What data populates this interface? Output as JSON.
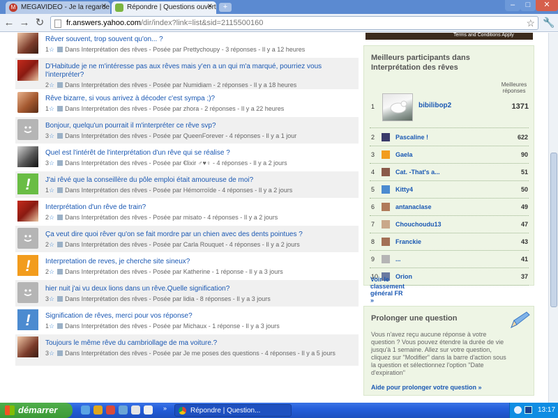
{
  "browser": {
    "tabs": [
      {
        "title": "MEGAVIDEO - Je la regarde",
        "favicon": "M",
        "active": false
      },
      {
        "title": "Répondre | Questions ouverte",
        "active": true
      }
    ],
    "url_host": "fr.answers.yahoo.com",
    "url_path": "/dir/index?link=list&sid=2115500160"
  },
  "ad": {
    "terms": "Terms and Conditions Apply"
  },
  "questions": [
    {
      "title": "Rêver souvent, trop souvent qu'on... ?",
      "stars": "1",
      "category": "Dans Interprétation des rêves",
      "asker": "Posée par Prettychoupy",
      "answers": "3 réponses",
      "age": "Il y a 12 heures",
      "avatar": "photo"
    },
    {
      "title": "D'Habitude je ne m'intéresse pas aux rêves mais y'en a un qui m'a marqué, pourriez vous l'interpréter?",
      "stars": "2",
      "category": "Dans Interprétation des rêves",
      "asker": "Posée par Numidiam",
      "answers": "2 réponses",
      "age": "Il y a 18 heures",
      "avatar": "photo"
    },
    {
      "title": "Rêve bizarre, si vous arrivez à décoder c'est sympa ;)?",
      "stars": "1",
      "category": "Dans Interprétation des rêves",
      "asker": "Posée par zhora",
      "answers": "2 réponses",
      "age": "Il y a 22 heures",
      "avatar": "photo"
    },
    {
      "title": "Bonjour, quelqu'un pourrait il m'interpréter ce rêve svp?",
      "stars": "3",
      "category": "Dans Interprétation des rêves",
      "asker": "Posée par QueenForever",
      "answers": "4 réponses",
      "age": "Il y a 1 jour",
      "avatar": "grey"
    },
    {
      "title": "Quel est l'intérêt de l'interprétation d'un rêve qui se réalise ?",
      "stars": "3",
      "category": "Dans Interprétation des rêves",
      "asker": "Posée par €lixir ♂♥♀",
      "answers": "4 réponses",
      "age": "Il y a 2 jours",
      "avatar": "photo"
    },
    {
      "title": "J'ai rêvé que la conseillère du pôle emploi était amoureuse de moi?",
      "stars": "1",
      "category": "Dans Interprétation des rêves",
      "asker": "Posée par Hémorroïde",
      "answers": "4 réponses",
      "age": "Il y a 2 jours",
      "avatar": "green"
    },
    {
      "title": "Interprétation d'un rêve de train?",
      "stars": "2",
      "category": "Dans Interprétation des rêves",
      "asker": "Posée par misato",
      "answers": "4 réponses",
      "age": "Il y a 2 jours",
      "avatar": "photo"
    },
    {
      "title": "Ça veut dire quoi rêver qu'on se fait mordre par un chien avec des dents pointues ?",
      "stars": "2",
      "category": "Dans Interprétation des rêves",
      "asker": "Posée par Carla Rouquet",
      "answers": "4 réponses",
      "age": "Il y a 2 jours",
      "avatar": "grey"
    },
    {
      "title": "Interpretation de reves, je cherche site sineux?",
      "stars": "2",
      "category": "Dans Interprétation des rêves",
      "asker": "Posée par Katherine",
      "answers": "1 réponse",
      "age": "Il y a 3 jours",
      "avatar": "orange"
    },
    {
      "title": "hier nuit j'ai vu deux lions dans un rêve.Quelle signification?",
      "stars": "3",
      "category": "Dans Interprétation des rêves",
      "asker": "Posée par lidia",
      "answers": "8 réponses",
      "age": "Il y a 3 jours",
      "avatar": "grey"
    },
    {
      "title": "Signification de rêves, merci pour vos réponse?",
      "stars": "1",
      "category": "Dans Interprétation des rêves",
      "asker": "Posée par Michaux",
      "answers": "1 réponse",
      "age": "Il y a 3 jours",
      "avatar": "blue"
    },
    {
      "title": "Toujours le même rêve du cambriollage de ma voiture.?",
      "stars": "3",
      "category": "Dans Interprétation des rêves",
      "asker": "Posée par Je me poses des questions",
      "answers": "4 réponses",
      "age": "Il y a 5 jours",
      "avatar": "photo"
    }
  ],
  "top_panel": {
    "heading": "Meilleurs participants dans Interprétation des rêves",
    "column_header": "Meilleures réponses",
    "first": {
      "rank": "1",
      "name": "bibilibop2",
      "score": "1371"
    },
    "others": [
      {
        "rank": "2",
        "name": "Pascaline !",
        "score": "622",
        "mini_color": "#3a3a6a"
      },
      {
        "rank": "3",
        "name": "Gaela",
        "score": "90",
        "mini_color": "#f29c1d"
      },
      {
        "rank": "4",
        "name": "Cat. -That's a...",
        "score": "51",
        "mini_color": "#8a5a4a"
      },
      {
        "rank": "5",
        "name": "Kitty4",
        "score": "50",
        "mini_color": "#4c8bd0"
      },
      {
        "rank": "6",
        "name": "antanaclase",
        "score": "49",
        "mini_color": "#b07a5a"
      },
      {
        "rank": "7",
        "name": "Chouchoudu13",
        "score": "47",
        "mini_color": "#c9a88a"
      },
      {
        "rank": "8",
        "name": "Franckie",
        "score": "43",
        "mini_color": "#a36f55"
      },
      {
        "rank": "9",
        "name": "...",
        "score": "41",
        "mini_color": "#b5b5b5"
      },
      {
        "rank": "10",
        "name": "Orion",
        "score": "37",
        "mini_color": "#6a7aa0"
      }
    ],
    "link": "Voir le classement général FR »"
  },
  "prolong_panel": {
    "title": "Prolonger une question",
    "text": "Vous n'avez reçu aucune réponse à votre question ? Vous pouvez étendre la durée de vie jusqu'à 1 semaine. Allez sur votre question, cliquez sur \"Modifier\" dans la barre d'action sous la question et sélectionnez l'option \"Date d'expiration\"",
    "link": "Aide pour prolonger votre question »"
  },
  "taskbar": {
    "start_label": "démarrer",
    "task_label": "Répondre | Question...",
    "clock": "13:17"
  }
}
